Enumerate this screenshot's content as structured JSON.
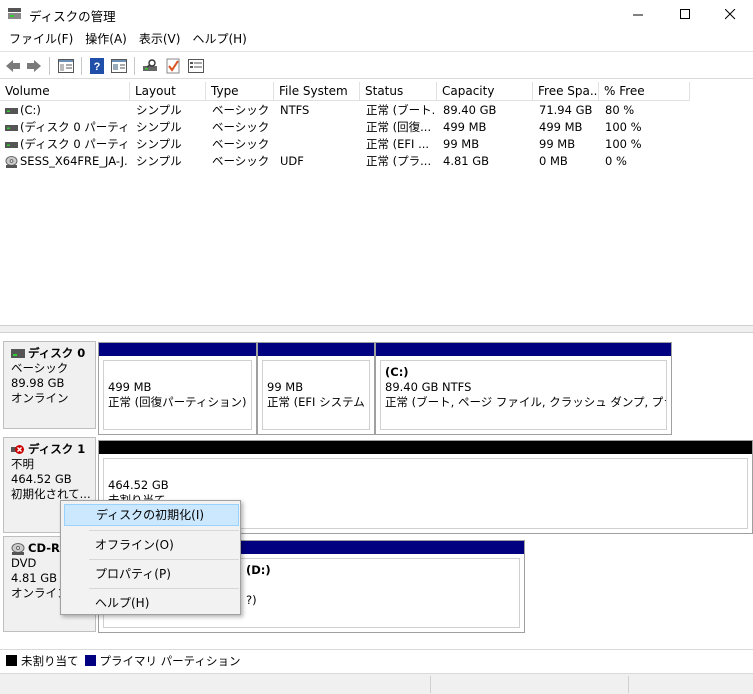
{
  "window": {
    "title": "ディスクの管理"
  },
  "menu": [
    "ファイル(F)",
    "操作(A)",
    "表示(V)",
    "ヘルプ(H)"
  ],
  "columns": [
    "Volume",
    "Layout",
    "Type",
    "File System",
    "Status",
    "Capacity",
    "Free Spa...",
    "% Free"
  ],
  "volumes": [
    {
      "volume": "(C:)",
      "layout": "シンプル",
      "type": "ベーシック",
      "fs": "NTFS",
      "status": "正常 (ブート...",
      "capacity": "89.40 GB",
      "free": "71.94 GB",
      "pct": "80 %",
      "icon": "drive-icon"
    },
    {
      "volume": "(ディスク 0 パーティシ...",
      "layout": "シンプル",
      "type": "ベーシック",
      "fs": "",
      "status": "正常 (回復...",
      "capacity": "499 MB",
      "free": "499 MB",
      "pct": "100 %",
      "icon": "drive-icon"
    },
    {
      "volume": "(ディスク 0 パーティシ...",
      "layout": "シンプル",
      "type": "ベーシック",
      "fs": "",
      "status": "正常 (EFI ...",
      "capacity": "99 MB",
      "free": "99 MB",
      "pct": "100 %",
      "icon": "drive-icon"
    },
    {
      "volume": "SESS_X64FRE_JA-J...",
      "layout": "シンプル",
      "type": "ベーシック",
      "fs": "UDF",
      "status": "正常 (プラ...",
      "capacity": "4.81 GB",
      "free": "0 MB",
      "pct": "0 %",
      "icon": "disc-icon"
    }
  ],
  "disks": [
    {
      "name": "ディスク 0",
      "kind": "ベーシック",
      "size": "89.98 GB",
      "state": "オンライン",
      "partitions": [
        {
          "label": "",
          "size": "499 MB",
          "status": "正常 (回復パーティション)"
        },
        {
          "label": "",
          "size": "99 MB",
          "status": "正常 (EFI システム パー"
        },
        {
          "label": "(C:)",
          "size": "89.40 GB NTFS",
          "status": "正常 (ブート, ページ ファイル, クラッシュ ダンプ, プライマリ パー"
        }
      ]
    },
    {
      "name": "ディスク 1",
      "kind": "不明",
      "size": "464.52 GB",
      "state": "初期化されて...",
      "partitions": [
        {
          "label": "",
          "size": "464.52 GB",
          "status": "未割り当て"
        }
      ]
    },
    {
      "name": "CD-ROM 0",
      "kind": "DVD",
      "size": "4.81 GB",
      "state": "オンライン",
      "partitions": [
        {
          "label": "(D:)",
          "size": "",
          "status": "?)"
        }
      ]
    }
  ],
  "context_menu": [
    "ディスクの初期化(I)",
    "オフライン(O)",
    "プロパティ(P)",
    "ヘルプ(H)"
  ],
  "legend": [
    "未割り当て",
    "プライマリ パーティション"
  ],
  "colors": {
    "primary": "#000080",
    "unallocated": "#000000",
    "highlight": "#cce8ff"
  }
}
